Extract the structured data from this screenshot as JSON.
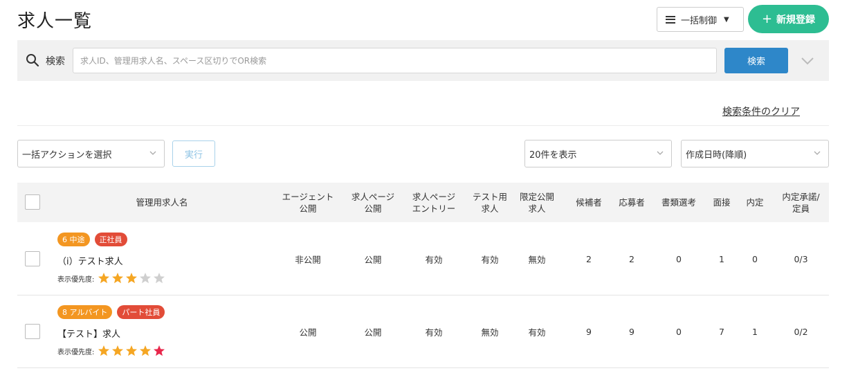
{
  "header": {
    "title": "求人一覧",
    "bulk_control_label": "一括制御",
    "new_button_label": "新規登録"
  },
  "search": {
    "label": "検索",
    "placeholder": "求人ID、管理用求人名、スペース区切りでOR検索",
    "button_label": "検索",
    "clear_label": "検索条件のクリア"
  },
  "controls": {
    "bulk_action_value": "一括アクションを選択",
    "run_label": "実行",
    "per_page_value": "20件を表示",
    "sort_value": "作成日時(降順)"
  },
  "table": {
    "columns": [
      "管理用求人名",
      "エージェント\n公開",
      "求人ページ\n公開",
      "求人ページ\nエントリー",
      "テスト用\n求人",
      "限定公開\n求人",
      "候補者",
      "応募者",
      "書類選考",
      "面接",
      "内定",
      "内定承諾/\n定員"
    ],
    "priority_label": "表示優先度:",
    "rows": [
      {
        "badges": [
          {
            "text": "6 中途",
            "color": "orange"
          },
          {
            "text": "正社員",
            "color": "red"
          }
        ],
        "name": "（i）テスト求人",
        "priority": 3,
        "agent_public": "非公開",
        "page_public": "公開",
        "page_entry": "有効",
        "test_job": "有効",
        "limited": "無効",
        "candidates": "2",
        "applicants": "2",
        "screening": "0",
        "interview": "1",
        "offer": "0",
        "acceptance": "0/3"
      },
      {
        "badges": [
          {
            "text": "8 アルバイト",
            "color": "orange"
          },
          {
            "text": "パート社員",
            "color": "red"
          }
        ],
        "name": "【テスト】求人",
        "priority": 5,
        "agent_public": "公開",
        "page_public": "公開",
        "page_entry": "有効",
        "test_job": "無効",
        "limited": "有効",
        "candidates": "9",
        "applicants": "9",
        "screening": "0",
        "interview": "7",
        "offer": "1",
        "acceptance": "0/2"
      }
    ]
  },
  "colors": {
    "accent_green": "#2dbd92",
    "search_blue": "#2e87c9",
    "badge_orange": "#f39621",
    "badge_red": "#e24c38",
    "star_filled": "#f5a623",
    "star_top": "#e8274b",
    "star_empty": "#cfcfcf"
  }
}
